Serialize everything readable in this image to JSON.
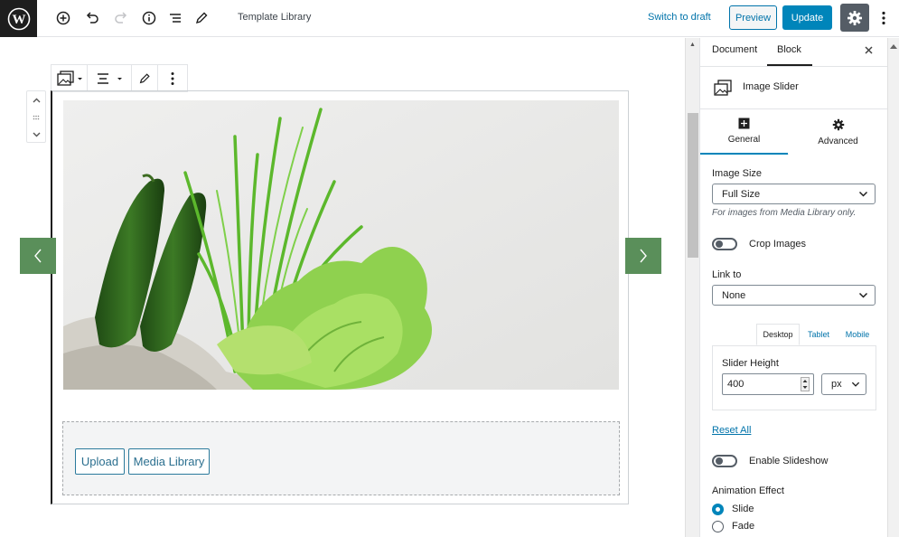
{
  "topbar": {
    "template_title": "Template Library",
    "switch_draft": "Switch to draft",
    "preview": "Preview",
    "update": "Update"
  },
  "canvas": {
    "upload_label": "Upload",
    "media_library_label": "Media Library"
  },
  "sidebar": {
    "tabs": [
      "Document",
      "Block"
    ],
    "active_tab": "Block",
    "block_name": "Image Slider",
    "subtabs": [
      "General",
      "Advanced"
    ],
    "image_size_label": "Image Size",
    "image_size_value": "Full Size",
    "image_size_hint": "For images from Media Library only.",
    "crop_images_label": "Crop Images",
    "link_to_label": "Link to",
    "link_to_value": "None",
    "device_tabs": [
      "Desktop",
      "Tablet",
      "Mobile"
    ],
    "active_device": "Desktop",
    "slider_height_label": "Slider Height",
    "slider_height_value": "400",
    "slider_height_unit": "px",
    "reset_all": "Reset All",
    "enable_slideshow_label": "Enable Slideshow",
    "animation_effect_label": "Animation Effect",
    "animation_options": [
      "Slide",
      "Fade"
    ],
    "animation_selected": "Slide"
  },
  "colors": {
    "accent": "#0085ba",
    "slider_arrow_bg": "#5a8f5a",
    "admin_dark": "#1e1e1e"
  }
}
